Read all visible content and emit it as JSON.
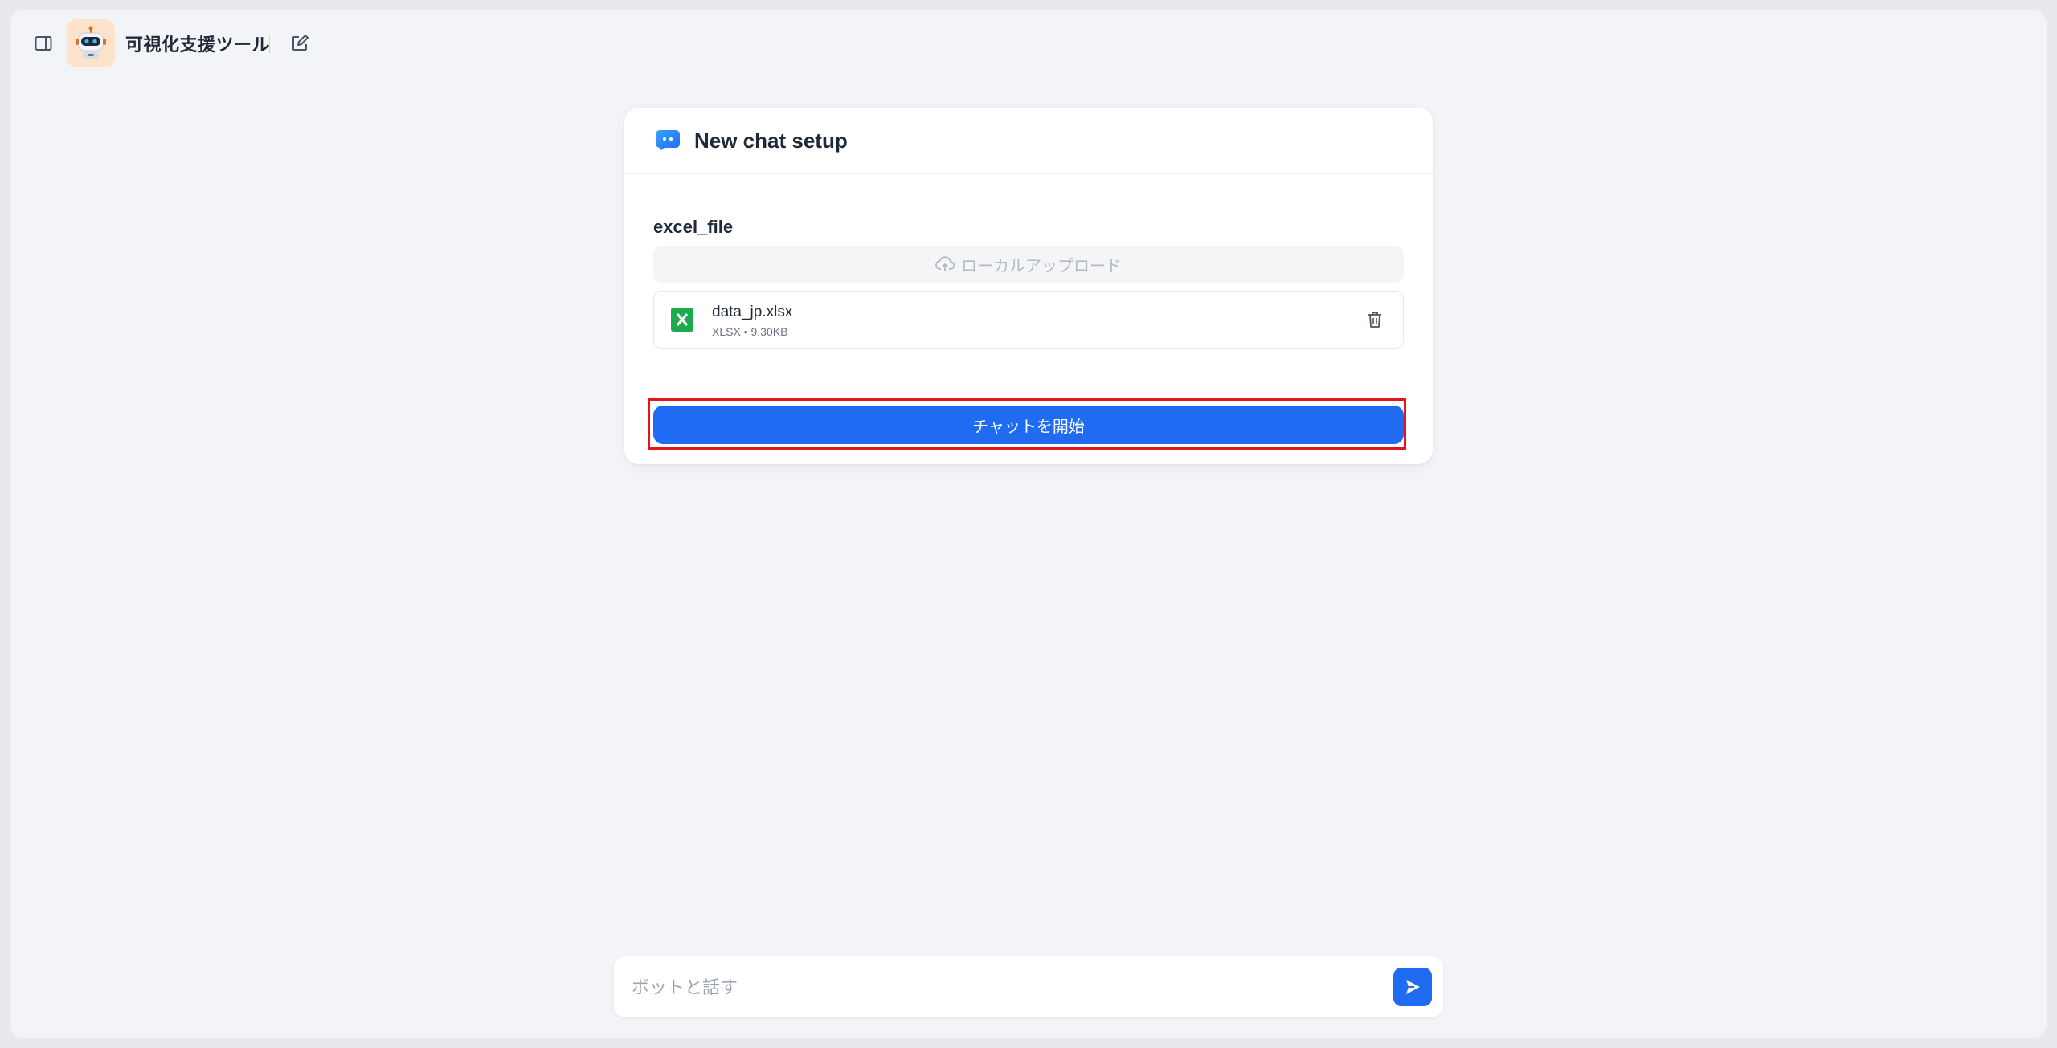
{
  "header": {
    "app_title": "可視化支援ツール",
    "icons": [
      "sidebar-toggle-icon",
      "robot-avatar-icon",
      "new-chat-icon"
    ]
  },
  "setup_card": {
    "title": "New chat setup",
    "field_label": "excel_file",
    "upload_label": "ローカルアップロード",
    "file": {
      "name": "data_jp.xlsx",
      "type": "XLSX",
      "separator": "•",
      "size": "9.30KB"
    },
    "start_button_label": "チャットを開始"
  },
  "chat": {
    "placeholder": "ボットと話す"
  },
  "colors": {
    "accent": "#1f6bf1",
    "highlight_border": "#e3141b",
    "excel_green": "#1eaa4f"
  }
}
